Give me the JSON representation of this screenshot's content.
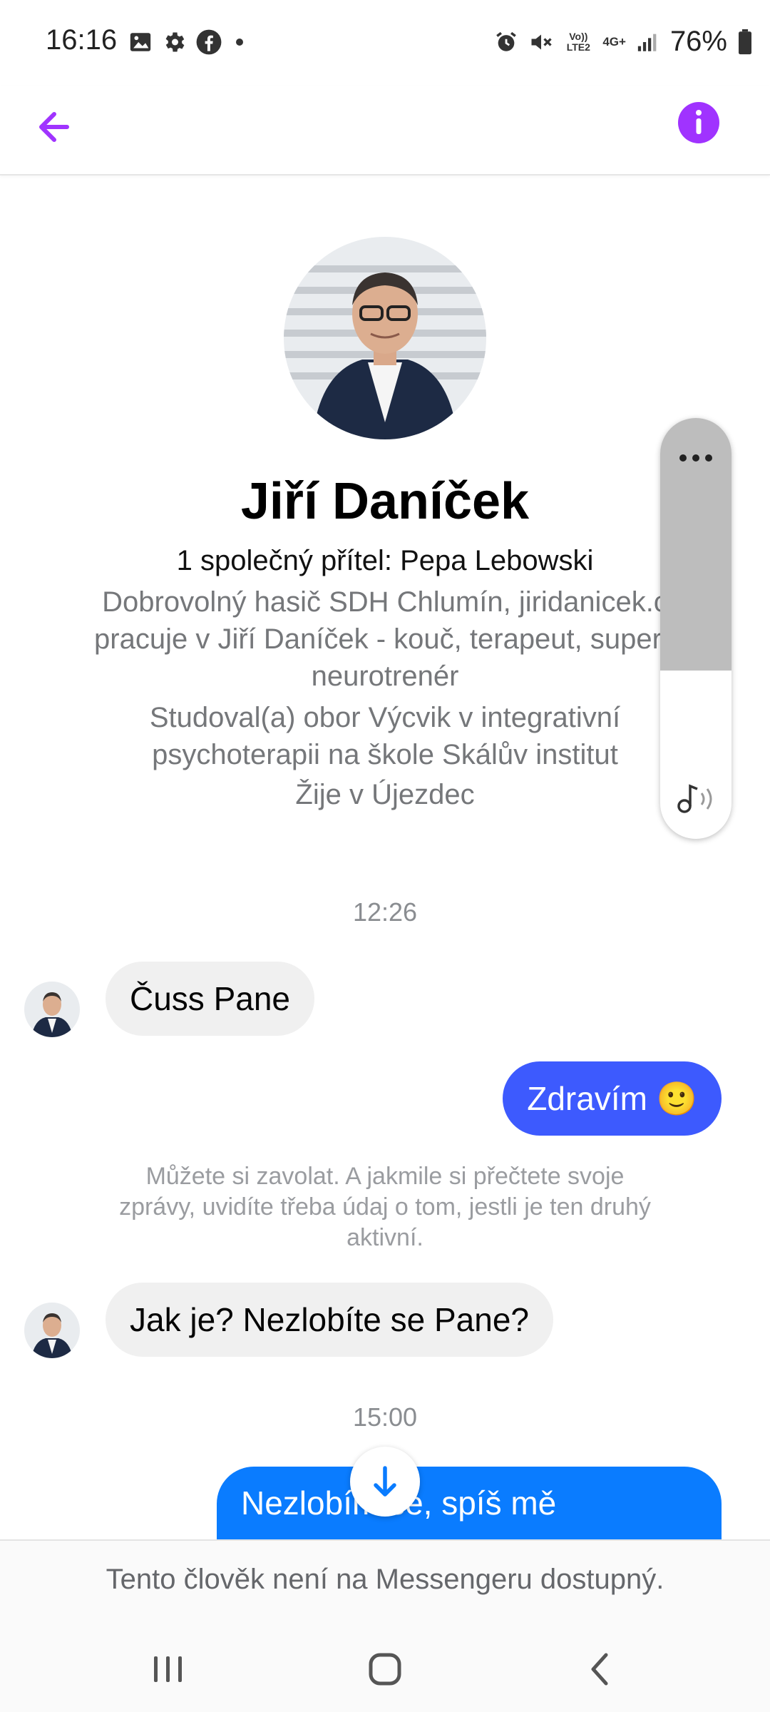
{
  "status_bar": {
    "time": "16:16",
    "battery": "76%",
    "icons_left": [
      "gallery-icon",
      "settings-icon",
      "facebook-icon",
      "dot-icon"
    ],
    "icons_right": [
      "alarm-icon",
      "mute-icon",
      "volte-icon",
      "4g-icon",
      "signal-icon",
      "battery-icon"
    ],
    "volte_label": "Vo)) LTE2",
    "network_label": "4G+"
  },
  "header": {
    "back_icon": "arrow-left-icon",
    "info_icon": "info-icon",
    "accent_color": "#a033ff"
  },
  "profile": {
    "name": "Jiří Daníček",
    "mutual_friends": "1 společný přítel: Pepa Lebowski",
    "bio_line1": "Dobrovolný hasič SDH Chlumín, jiridanicek.c",
    "bio_line2": "pracuje v Jiří Daníček - kouč, terapeut, superv",
    "bio_line3": "neurotrenér",
    "study_line1": "Studoval(a) obor Výcvik v integrativní",
    "study_line2": "psychoterapii na škole Skálův institut",
    "lives": "Žije v Újezdec"
  },
  "conversation": {
    "timestamp1": "12:26",
    "msg1": "Čuss Pane",
    "msg2": "Zdravím 🙂",
    "system_note": "Můžete si zavolat. A jakmile si přečtete svoje zprávy, uvidíte třeba údaj o tom, jestli je ten druhý aktivní.",
    "msg3": "Jak je? Nezlobíte se Pane?",
    "timestamp2": "15:00",
    "msg4_line1": "Nezlobím se, spíš mě",
    "outgoing_color": "#3d5afe",
    "outgoing_color_last": "#0a7cff"
  },
  "footer": {
    "unavailable": "Tento člověk není na Messengeru dostupný."
  },
  "navbar": {
    "recent_icon": "recent-apps-icon",
    "home_icon": "home-icon",
    "back_icon": "nav-back-icon"
  }
}
